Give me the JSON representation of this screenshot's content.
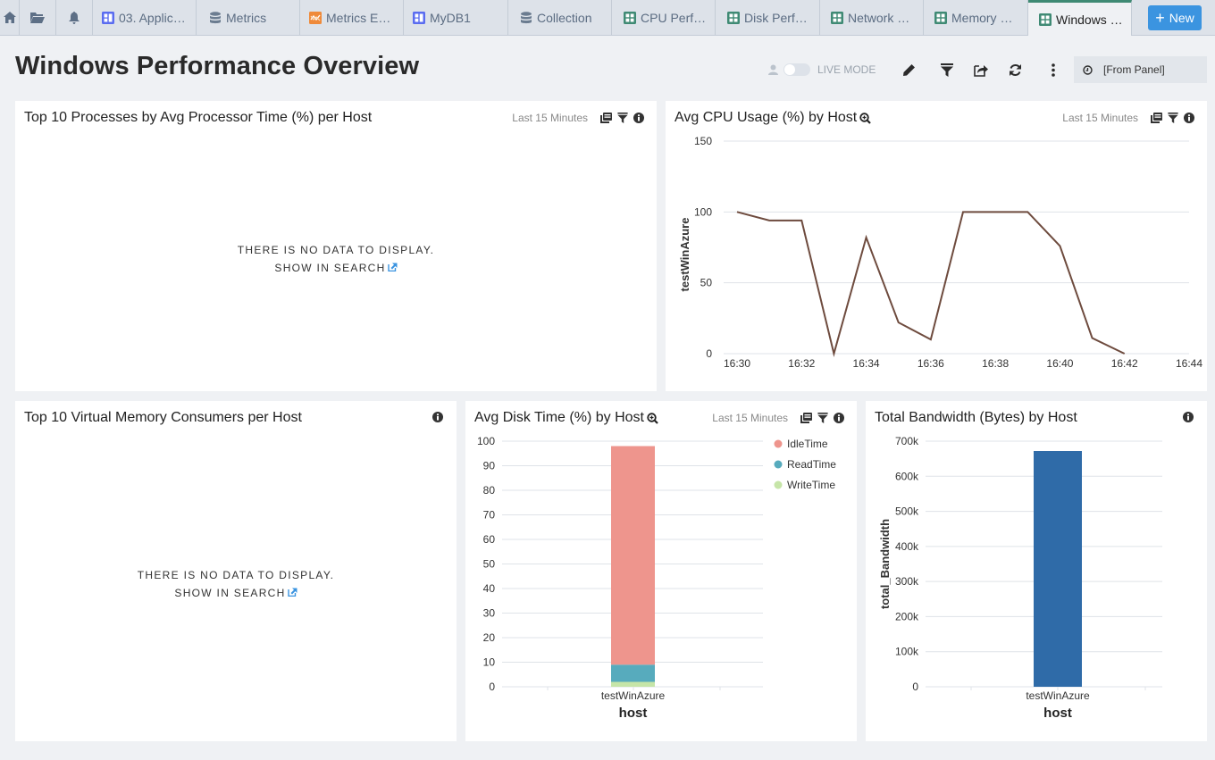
{
  "tabs": {
    "icon_tabs": [
      {
        "name": "home",
        "icon": "home-icon"
      },
      {
        "name": "folder",
        "icon": "folder-icon"
      },
      {
        "name": "alerts",
        "icon": "bell-icon"
      }
    ],
    "items": [
      {
        "label": "03. Applic…",
        "icon": "dashboard-icon",
        "icon_color": "#5a6cf0",
        "active": false
      },
      {
        "label": "Metrics",
        "icon": "database-icon",
        "icon_color": "#6b7c90",
        "active": false
      },
      {
        "label": "Metrics E…",
        "icon": "metrics-explorer-icon",
        "icon_color": "#ef8a3a",
        "active": false
      },
      {
        "label": "MyDB1",
        "icon": "dashboard-icon",
        "icon_color": "#5a6cf0",
        "active": false
      },
      {
        "label": "Collection",
        "icon": "database-icon",
        "icon_color": "#6b7c90",
        "active": false
      },
      {
        "label": "CPU Perf…",
        "icon": "app-dashboard-icon",
        "icon_color": "#3f8a74",
        "active": false
      },
      {
        "label": "Disk Perf…",
        "icon": "app-dashboard-icon",
        "icon_color": "#3f8a74",
        "active": false
      },
      {
        "label": "Network …",
        "icon": "app-dashboard-icon",
        "icon_color": "#3f8a74",
        "active": false
      },
      {
        "label": "Memory …",
        "icon": "app-dashboard-icon",
        "icon_color": "#3f8a74",
        "active": false
      },
      {
        "label": "Windows …",
        "icon": "app-dashboard-icon",
        "icon_color": "#3f8a74",
        "active": true
      }
    ],
    "new_label": "New"
  },
  "header": {
    "title": "Windows Performance Overview",
    "live_mode_label": "LIVE MODE",
    "live_mode_on": false,
    "time_range": "[From Panel]"
  },
  "panels": {
    "processes": {
      "title": "Top 10 Processes by Avg Processor Time (%) per Host",
      "range": "Last 15 Minutes",
      "no_data": "THERE IS NO DATA TO DISPLAY.",
      "show_in_search": "SHOW IN SEARCH"
    },
    "cpu": {
      "title": "Avg CPU Usage (%) by Host",
      "range": "Last 15 Minutes"
    },
    "vmem": {
      "title": "Top 10 Virtual Memory Consumers per Host",
      "no_data": "THERE IS NO DATA TO DISPLAY.",
      "show_in_search": "SHOW IN SEARCH"
    },
    "disk": {
      "title": "Avg Disk Time (%) by Host",
      "range": "Last 15 Minutes"
    },
    "bandwidth": {
      "title": "Total Bandwidth (Bytes) by Host"
    }
  },
  "chart_data": [
    {
      "id": "cpu",
      "type": "line",
      "title": "Avg CPU Usage (%) by Host",
      "xlabel": "",
      "ylabel": "testWinAzure",
      "x": [
        "16:30",
        "16:31",
        "16:32",
        "16:33",
        "16:34",
        "16:35",
        "16:36",
        "16:37",
        "16:38",
        "16:39",
        "16:40",
        "16:41",
        "16:42"
      ],
      "x_ticks": [
        "16:30",
        "16:32",
        "16:34",
        "16:36",
        "16:38",
        "16:40",
        "16:42",
        "16:44"
      ],
      "x_range_minutes": [
        0,
        14
      ],
      "series": [
        {
          "name": "testWinAzure",
          "color": "#6e4b3e",
          "values": [
            100,
            94,
            94,
            0,
            82,
            22,
            10,
            100,
            100,
            100,
            76,
            11,
            0
          ]
        }
      ],
      "ylim": [
        0,
        150
      ],
      "y_ticks": [
        0,
        50,
        100,
        150
      ],
      "grid": true
    },
    {
      "id": "disk",
      "type": "bar",
      "stacked": true,
      "title": "Avg Disk Time (%) by Host",
      "xlabel": "host",
      "ylabel": "",
      "categories": [
        "testWinAzure"
      ],
      "series": [
        {
          "name": "WriteTime",
          "color": "#c6e5a8",
          "values": [
            2
          ]
        },
        {
          "name": "ReadTime",
          "color": "#57abbd",
          "values": [
            7
          ]
        },
        {
          "name": "IdleTime",
          "color": "#ee958d",
          "values": [
            89
          ]
        }
      ],
      "legend": [
        "IdleTime",
        "ReadTime",
        "WriteTime"
      ],
      "legend_position": "right",
      "ylim": [
        0,
        100
      ],
      "y_ticks": [
        0,
        10,
        20,
        30,
        40,
        50,
        60,
        70,
        80,
        90,
        100
      ],
      "grid": true
    },
    {
      "id": "bandwidth",
      "type": "bar",
      "title": "Total Bandwidth (Bytes) by Host",
      "xlabel": "host",
      "ylabel": "total_Bandwidth",
      "categories": [
        "testWinAzure"
      ],
      "series": [
        {
          "name": "total_Bandwidth",
          "color": "#2f6ba8",
          "values": [
            672000
          ]
        }
      ],
      "ylim": [
        0,
        700000
      ],
      "y_ticks": [
        0,
        100000,
        200000,
        300000,
        400000,
        500000,
        600000,
        700000
      ],
      "y_tick_labels": [
        "0",
        "100k",
        "200k",
        "300k",
        "400k",
        "500k",
        "600k",
        "700k"
      ],
      "grid": true
    }
  ]
}
